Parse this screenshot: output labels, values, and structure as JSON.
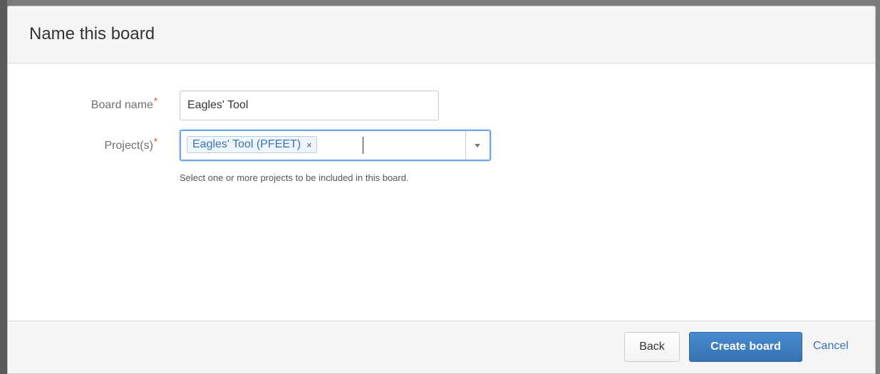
{
  "dialog": {
    "title": "Name this board"
  },
  "form": {
    "board_name": {
      "label": "Board name",
      "required_marker": "*",
      "value": "Eagles' Tool"
    },
    "projects": {
      "label": "Project(s)",
      "required_marker": "*",
      "selected": [
        {
          "label": "Eagles' Tool (PFEET)",
          "remove_glyph": "×"
        }
      ],
      "help_text": "Select one or more projects to be included in this board.",
      "dropdown_icon": "chevron-down-icon"
    }
  },
  "footer": {
    "back_label": "Back",
    "create_label": "Create board",
    "cancel_label": "Cancel"
  },
  "colors": {
    "accent": "#3572b0",
    "link": "#3b73af",
    "required": "#d04437",
    "focus_border": "#6aa4e8"
  }
}
